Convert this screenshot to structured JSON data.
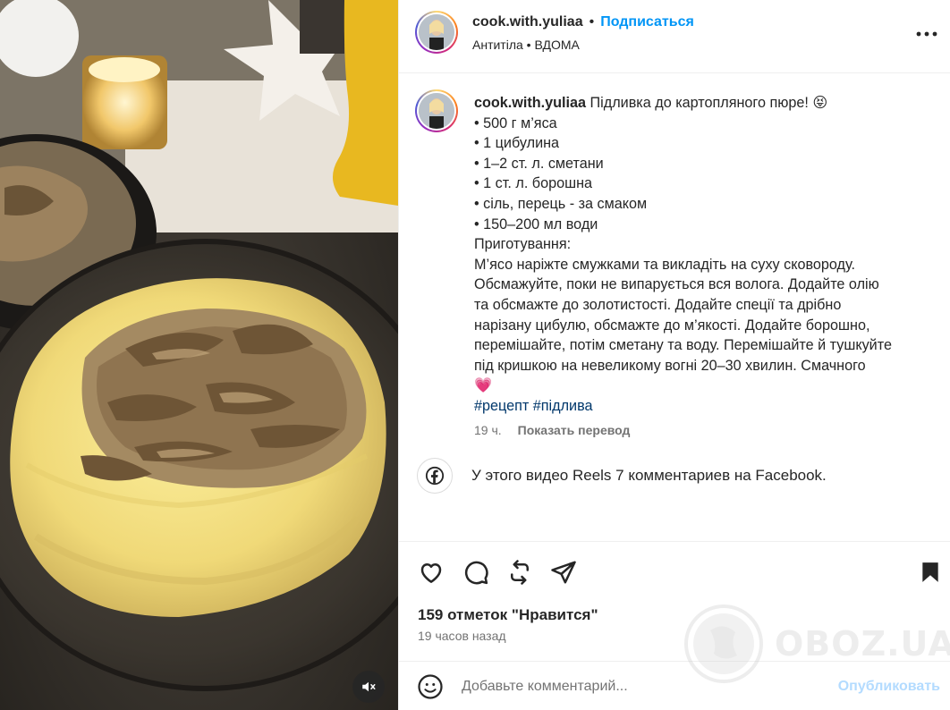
{
  "colors": {
    "accent": "#0095f6",
    "hashtag": "#00376b",
    "muted": "#737373",
    "heart": "#ed4956"
  },
  "header": {
    "username": "cook.with.yuliaa",
    "separator": "•",
    "follow_label": "Подписаться",
    "subtitle": "Антитіла • ВДОМА",
    "more_icon": "more-horizontal-icon"
  },
  "caption": {
    "username": "cook.with.yuliaa",
    "title": "Підливка до картопляного пюре! 😝",
    "lines": [
      "• 500 г м’яса",
      "• 1 цибулина",
      "• 1–2 ст. л. сметани",
      "• 1 ст. л. борошна",
      "• сіль, перець - за смаком",
      "• 150–200 мл води",
      "Приготування:",
      "М’ясо наріжте смужками та викладіть на суху сковороду.",
      "Обсмажуйте, поки не випарується вся волога. Додайте олію",
      "та обсмажте до золотистості. Додайте спеції та дрібно",
      "нарізану цибулю, обсмажте до м’якості. Додайте борошно,",
      "перемішайте, потім сметану та воду. Перемішайте й тушкуйте",
      "під кришкою на невеликому вогні 20–30 хвилин. Смачного",
      "💗"
    ],
    "hashtags": [
      "#рецепт",
      "#підлива"
    ],
    "time": "19 ч.",
    "translate_label": "Показать перевод"
  },
  "facebook": {
    "text": "У этого видео Reels 7 комментариев на Facebook."
  },
  "actions": {
    "icons": [
      "heart-icon",
      "comment-icon",
      "repost-icon",
      "share-icon",
      "bookmark-icon"
    ],
    "likes": "159 отметок \"Нравится\"",
    "ago": "19 часов назад"
  },
  "comment": {
    "placeholder": "Добавьте комментарий...",
    "publish_label": "Опубликовать"
  },
  "watermark": {
    "text": "OBOZ.UA"
  }
}
